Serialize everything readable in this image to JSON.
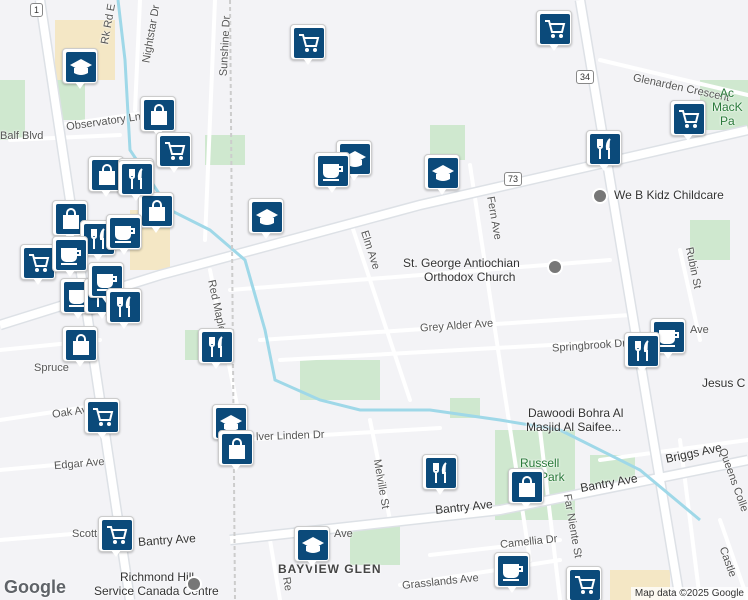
{
  "map": {
    "attribution": "Map data ©2025 Google",
    "logo": "Google",
    "shields": [
      "1",
      "34",
      "73"
    ],
    "streets": {
      "elgin_mills": "Rk Rd E",
      "nightstar": "Nightstar Dr",
      "sunshine": "Sunshine Dr",
      "observatory": "Observatory Ln",
      "balf": "Balf Blvd",
      "elm": "Elm Ave",
      "fern": "Fern Ave",
      "glenarden": "Glenarden Crescent",
      "rubin": "Rubin St",
      "grey_alder": "Grey Alder Ave",
      "springbrook": "Springbrook Dr",
      "red_maple": "Red Maple",
      "spruce": "Spruce",
      "oak": "Oak Ave",
      "edgar": "Edgar Ave",
      "silver_linden": "lver Linden Dr",
      "melville": "Melville St",
      "bantry_main": "Bantry Ave",
      "bantry_west": "Bantry Ave",
      "bantry_east": "Bantry Ave",
      "scott": "Scott",
      "briggs": "Briggs Ave",
      "queens": "Queens Colle",
      "castle": "Castle",
      "far_niente": "Far Niente St",
      "camellia": "Camellia Dr",
      "grasslands": "Grasslands Ave",
      "red_bottom": "Re",
      "ave_short": "Ave",
      "ave_right": "Ave",
      "rk_label": "Rk Rd E"
    },
    "places": {
      "we_b_kidz": "We B Kidz Childcare",
      "st_george_1": "St. George Antiochian",
      "st_george_2": "Orthodox Church",
      "dawoodi_1": "Dawoodi Bohra Al",
      "dawoodi_2": "Masjid Al Saifee...",
      "russell_1": "Russell",
      "russell_2": "Park",
      "jesus": "Jesus C",
      "bayview": "BAYVIEW GLEN",
      "richmond_1": "Richmond Hill",
      "richmond_2": "Service Canada Centre",
      "ac_1": "Ac",
      "ac_2": "MacK",
      "ac_3": "Pa"
    },
    "pins": [
      {
        "icon": "cart"
      },
      {
        "icon": "cart"
      },
      {
        "icon": "school"
      },
      {
        "icon": "bag"
      },
      {
        "icon": "cart"
      },
      {
        "icon": "cart"
      },
      {
        "icon": "bag"
      },
      {
        "icon": "cart"
      },
      {
        "icon": "restaurant"
      },
      {
        "icon": "school"
      },
      {
        "icon": "coffee"
      },
      {
        "icon": "school"
      },
      {
        "icon": "bag"
      },
      {
        "icon": "restaurant"
      },
      {
        "icon": "bag"
      },
      {
        "icon": "coffee"
      },
      {
        "icon": "restaurant"
      },
      {
        "icon": "cart"
      },
      {
        "icon": "coffee"
      },
      {
        "icon": "coffee"
      },
      {
        "icon": "restaurant"
      },
      {
        "icon": "coffee"
      },
      {
        "icon": "bag"
      },
      {
        "icon": "restaurant"
      },
      {
        "icon": "restaurant"
      },
      {
        "icon": "coffee"
      },
      {
        "icon": "school"
      },
      {
        "icon": "cart"
      },
      {
        "icon": "school"
      },
      {
        "icon": "bag"
      },
      {
        "icon": "restaurant"
      },
      {
        "icon": "bag"
      },
      {
        "icon": "cart"
      },
      {
        "icon": "school"
      },
      {
        "icon": "coffee"
      },
      {
        "icon": "cart"
      },
      {
        "icon": "restaurant"
      }
    ]
  }
}
